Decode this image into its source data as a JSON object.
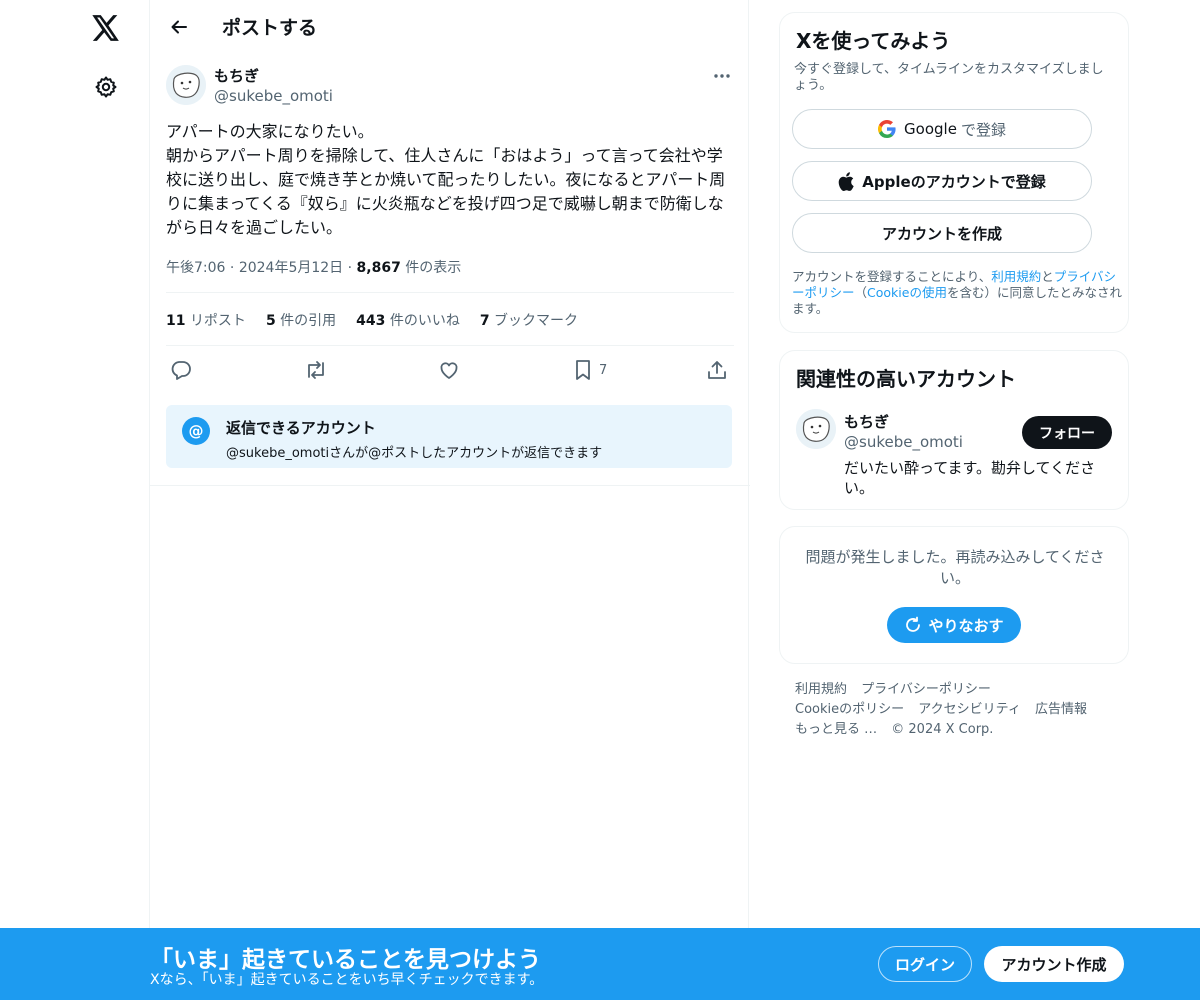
{
  "nav": {
    "logo_icon": "x-logo-icon",
    "settings_icon": "gear-icon"
  },
  "header": {
    "back_icon": "arrow-left-icon",
    "title": "ポストする"
  },
  "post": {
    "author_name": "もちぎ",
    "author_handle": "@sukebe_omoti",
    "text": "アパートの大家になりたい。\n朝からアパート周りを掃除して、住人さんに「おはよう」って言って会社や学校に送り出し、庭で焼き芋とか焼いて配ったりしたい。夜になるとアパート周りに集まってくる『奴ら』に火炎瓶などを投げ四つ足で威嚇し朝まで防衛しながら日々を過ごしたい。",
    "time": "午後7:06",
    "date": "2024年5月12日",
    "views_count": "8,867",
    "views_label": "件の表示",
    "stats": {
      "reposts_count": "11",
      "reposts_label": "リポスト",
      "quotes_count": "5",
      "quotes_label": "件の引用",
      "likes_count": "443",
      "likes_label": "件のいいね",
      "bookmarks_count": "7",
      "bookmarks_label": "ブックマーク"
    },
    "actions": {
      "bookmark_count": "7"
    },
    "reply_restriction": {
      "at_symbol": "@",
      "title": "返信できるアカウント",
      "description": "@sukebe_omotiさんが@ポストしたアカウントが返信できます"
    }
  },
  "signup_card": {
    "title": "Xを使ってみよう",
    "subtitle": "今すぐ登録して、タイムラインをカスタマイズしましょう。",
    "google_brand": "Google",
    "google_suffix": "で登録",
    "apple_label": "Appleのアカウントで登録",
    "create_label": "アカウントを作成",
    "legal_prefix": "アカウントを登録することにより、",
    "legal_terms": "利用規約",
    "legal_and": "と",
    "legal_privacy": "プライバシーポリシー",
    "legal_paren_open": "（",
    "legal_cookie": "Cookieの使用",
    "legal_suffix": "を含む）に同意したとみなされます。"
  },
  "related_card": {
    "title": "関連性の高いアカウント",
    "name": "もちぎ",
    "handle": "@sukebe_omoti",
    "bio": "だいたい酔ってます。勘弁してください。",
    "follow_label": "フォロー"
  },
  "error_card": {
    "message": "問題が発生しました。再読み込みしてください。",
    "retry_label": "やりなおす"
  },
  "footer": {
    "terms": "利用規約",
    "privacy": "プライバシーポリシー",
    "cookie": "Cookieのポリシー",
    "accessibility": "アクセシビリティ",
    "ads": "広告情報",
    "more": "もっと見る …",
    "copyright": "© 2024 X Corp."
  },
  "bottom_bar": {
    "title": "「いま」起きていることを見つけよう",
    "subtitle": "Xなら、「いま」起きていることをいち早くチェックできます。",
    "login_label": "ログイン",
    "signup_label": "アカウント作成"
  },
  "colors": {
    "accent": "#1d9bf0",
    "text_primary": "#0f1419",
    "text_secondary": "#536471",
    "border": "#eff3f4"
  }
}
